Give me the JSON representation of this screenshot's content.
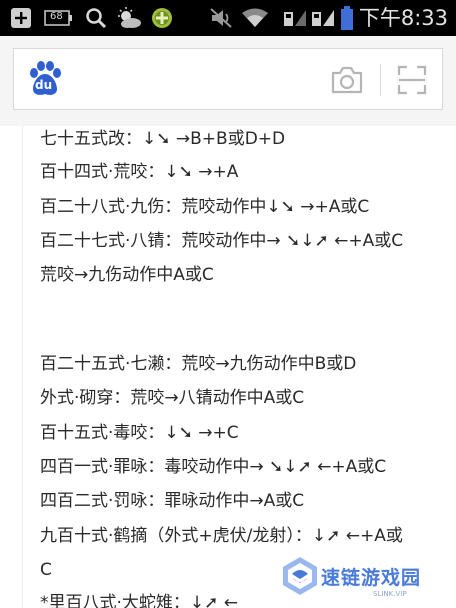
{
  "status_bar": {
    "battery_indicator": "68",
    "time": "下午8:33",
    "icons": [
      "add-box-icon",
      "battery-68-icon",
      "search-icon",
      "weather-icon",
      "game-app-icon",
      "mute-icon",
      "wifi-icon",
      "sim1-signal-icon",
      "sim2-signal-icon",
      "battery-icon"
    ]
  },
  "search_bar": {
    "logo": "baidu-paw-logo",
    "logo_text": "du",
    "icons": [
      "camera-icon",
      "scan-icon"
    ]
  },
  "content": {
    "lines": [
      "七十五式改：↓➘ →B+B或D+D",
      "百十四式·荒咬：↓➘ →+A",
      "百二十八式·九伤：荒咬动作中↓➘ →+A或C",
      "百二十七式·八锖：荒咬动作中→ ➘↓➚ ←+A或C",
      "荒咬→九伤动作中A或C",
      "百二十五式·七濑：荒咬→九伤动作中B或D",
      "外式·砌穿：荒咬→八锖动作中A或C",
      "百十五式·毒咬：↓➘ →+C",
      "四百一式·罪咏：毒咬动作中→ ➘↓➚ ←+A或C",
      "四百二式·罚咏：罪咏动作中→A或C",
      "九百十式·鹤摘（外式+虎伏/龙射）：↓➚ ←+A或",
      "C",
      "*里百八式·大蛇雉：↓➚ ←"
    ]
  },
  "watermark": {
    "title": "速链游戏园",
    "subtitle": "SLINK.VIP"
  },
  "colors": {
    "status_bar_bg": "#000000",
    "search_area_bg": "#f5f5f5",
    "baidu_blue": "#2f5fd0",
    "text": "#2a2a2a",
    "watermark_blue": "#4a7bd8"
  }
}
